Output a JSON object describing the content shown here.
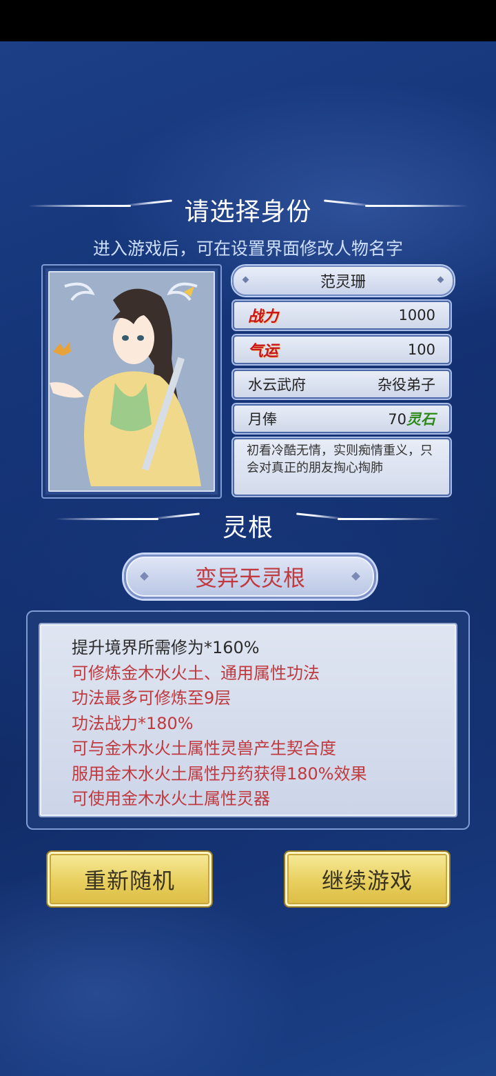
{
  "header": {
    "title": "请选择身份",
    "subtitle": "进入游戏后，可在设置界面修改人物名字"
  },
  "character": {
    "name": "范灵珊",
    "stats": [
      {
        "label": "战力",
        "value": "1000"
      },
      {
        "label": "气运",
        "value": "100"
      }
    ],
    "sect": "水云武府",
    "rank": "杂役弟子",
    "salary_label": "月俸",
    "salary_value": "70",
    "salary_unit": "灵石",
    "description": "初看冷酷无情，实则痴情重义，只会对真正的朋友掏心掏肺"
  },
  "spirit_root": {
    "section_title": "灵根",
    "name": "变异天灵根",
    "effects": [
      "提升境界所需修为*160%",
      "可修炼金木水火土、通用属性功法",
      "功法最多可修炼至9层",
      "功法战力*180%",
      "可与金木水火土属性灵兽产生契合度",
      "服用金木水火土属性丹药获得180%效果",
      "可使用金木水火土属性灵器"
    ]
  },
  "buttons": {
    "reroll": "重新随机",
    "continue": "继续游戏"
  },
  "colors": {
    "background": "#13306b",
    "accent_red": "#c0393f",
    "button_gold": "#e8cf5e",
    "salary_green": "#2d8a1a"
  }
}
